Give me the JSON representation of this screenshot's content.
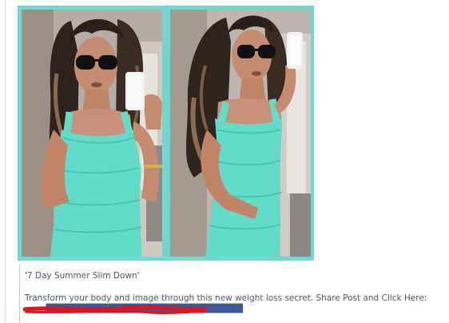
{
  "post": {
    "title": "'7 Day Summer Slim Down'",
    "body": "Transform your body and image through this new weight loss secret. Share Post and Click Here:",
    "link": "www.████████████████████████████████"
  },
  "colors": {
    "frame": "#6fd9cf",
    "dress": "#62dcc8",
    "caption_text": "#4e5665",
    "redaction": "#e0141c"
  }
}
